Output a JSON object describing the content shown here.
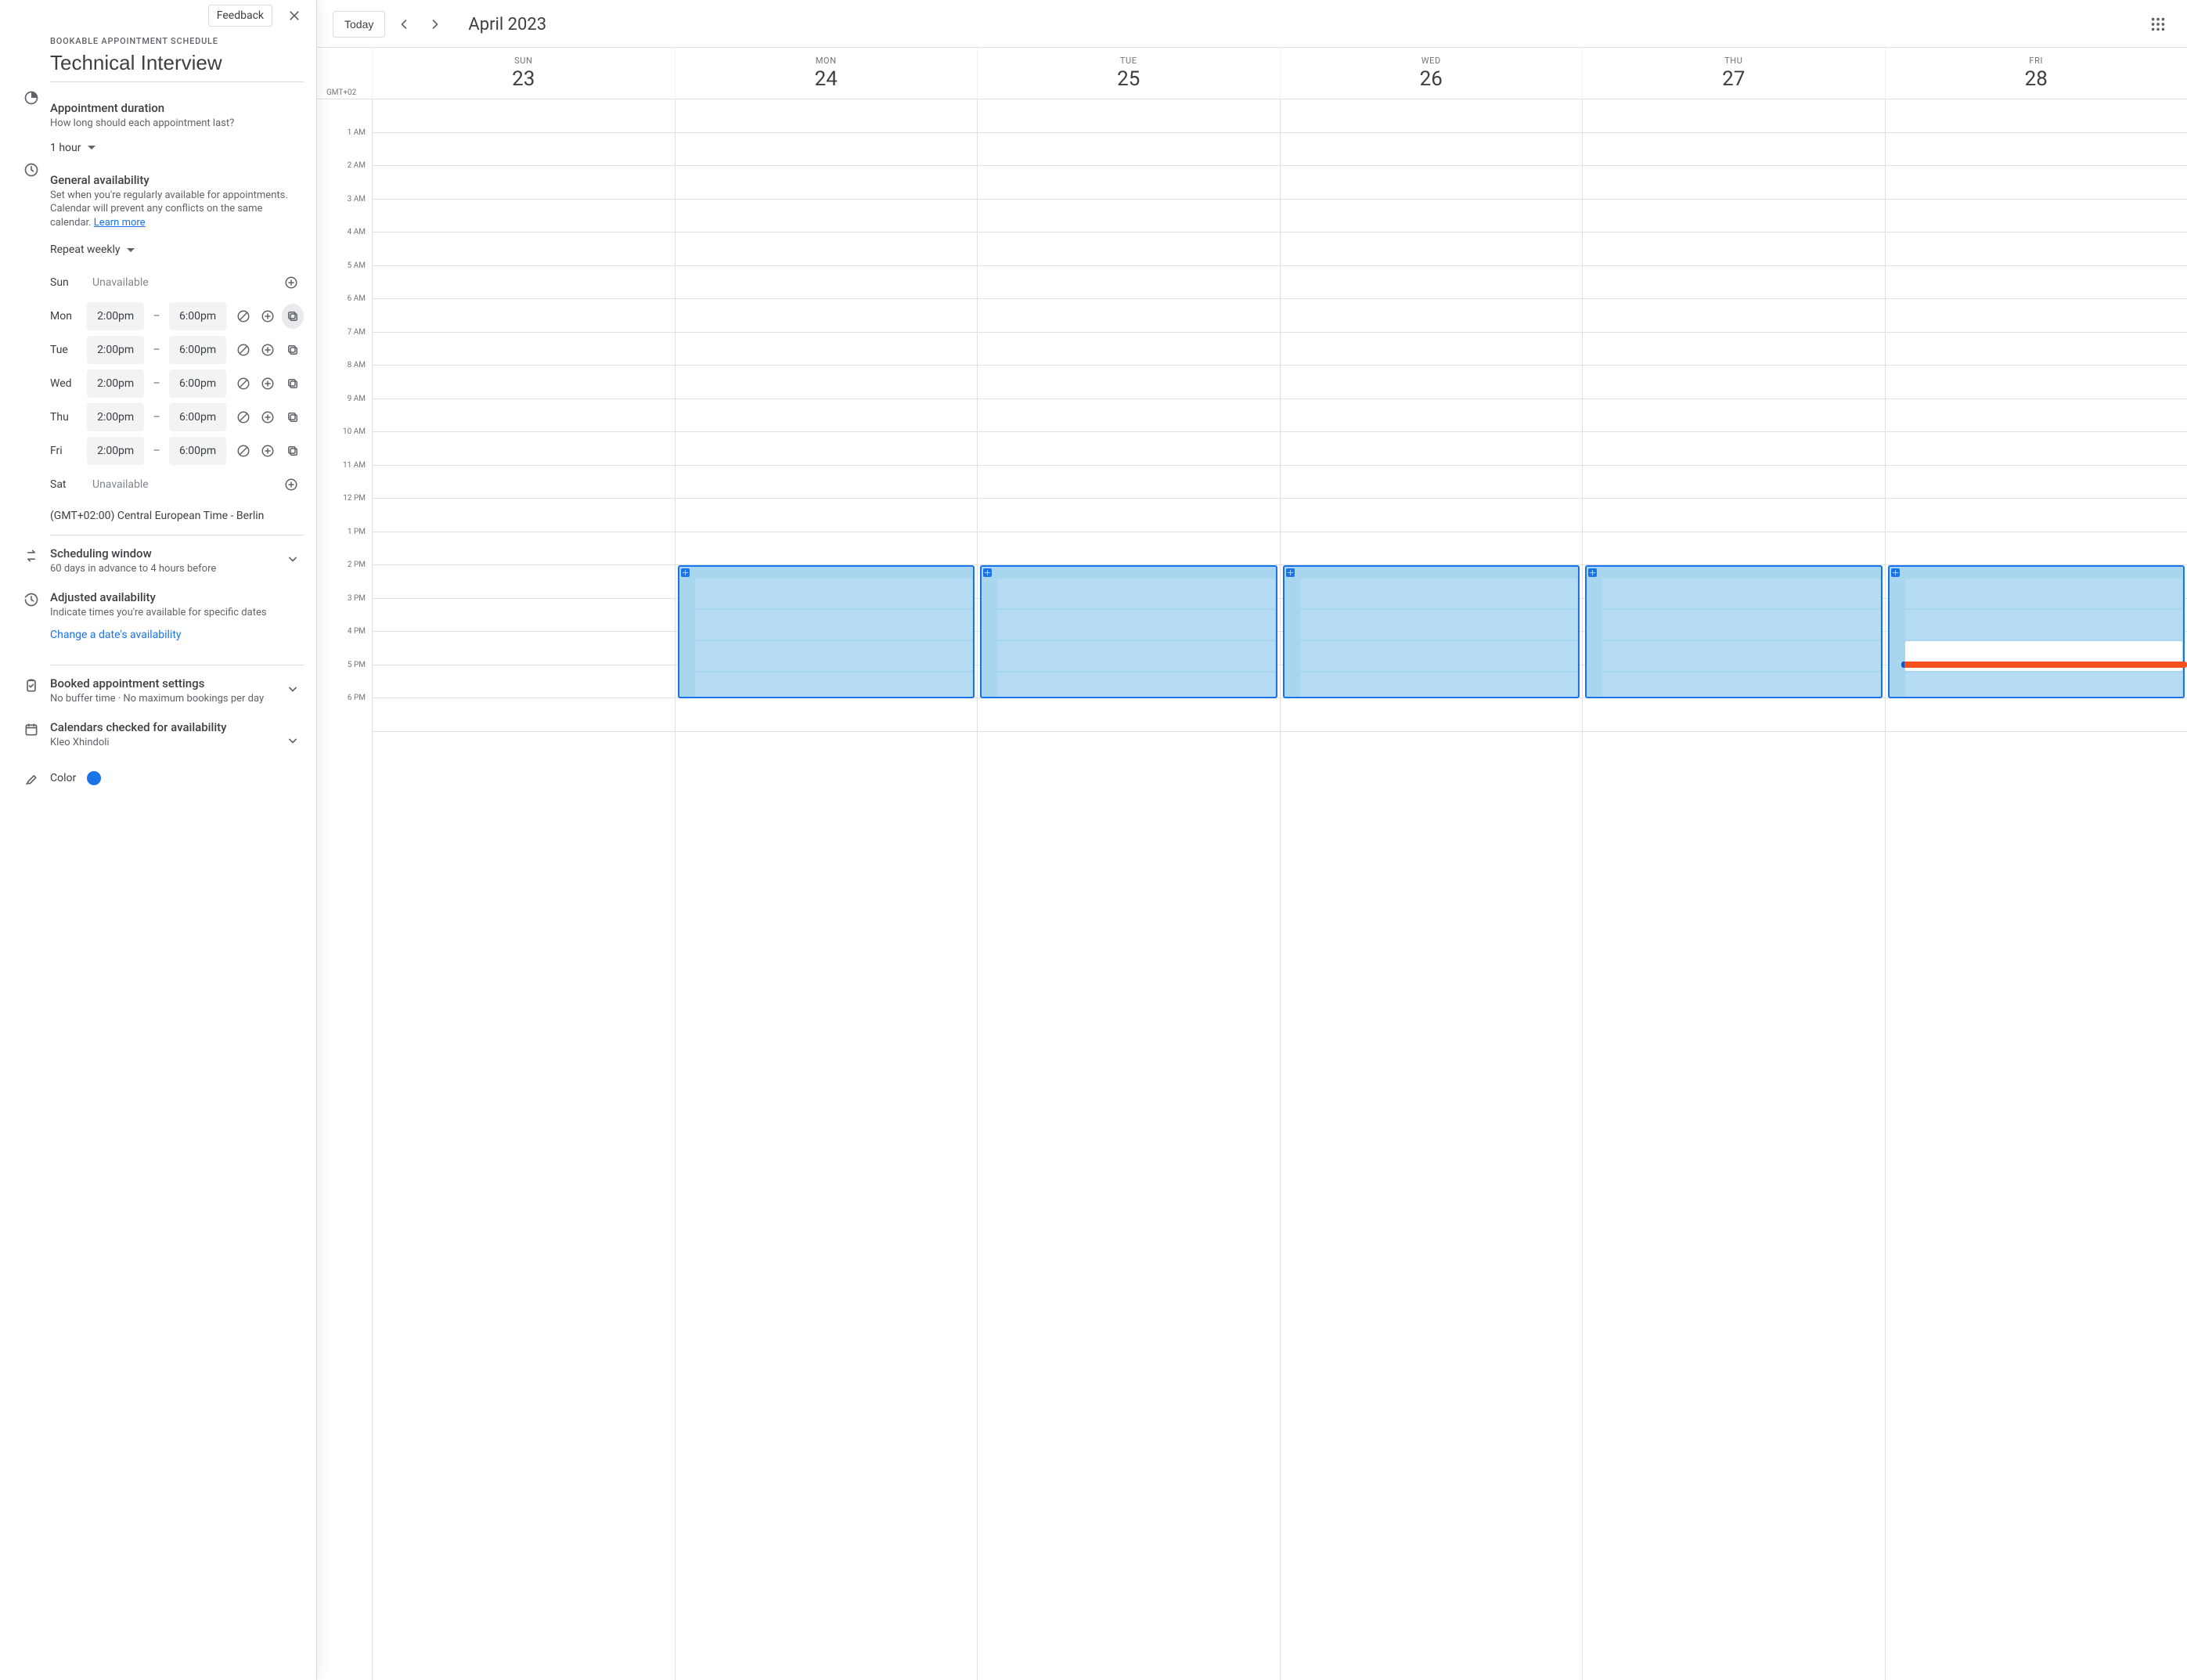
{
  "sidebar": {
    "feedback": "Feedback",
    "kicker": "BOOKABLE APPOINTMENT SCHEDULE",
    "title": "Technical Interview",
    "duration": {
      "heading": "Appointment duration",
      "sub": "How long should each appointment last?",
      "value": "1 hour"
    },
    "availability": {
      "heading": "General availability",
      "sub": "Set when you're regularly available for appointments. Calendar will prevent any conflicts on the same calendar. ",
      "learn_more": "Learn more",
      "repeat": "Repeat weekly",
      "days": [
        {
          "label": "Sun",
          "unavailable": true,
          "unavailable_text": "Unavailable"
        },
        {
          "label": "Mon",
          "start": "2:00pm",
          "end": "6:00pm"
        },
        {
          "label": "Tue",
          "start": "2:00pm",
          "end": "6:00pm"
        },
        {
          "label": "Wed",
          "start": "2:00pm",
          "end": "6:00pm"
        },
        {
          "label": "Thu",
          "start": "2:00pm",
          "end": "6:00pm"
        },
        {
          "label": "Fri",
          "start": "2:00pm",
          "end": "6:00pm"
        },
        {
          "label": "Sat",
          "unavailable": true,
          "unavailable_text": "Unavailable"
        }
      ],
      "timezone": "(GMT+02:00) Central European Time - Berlin"
    },
    "scheduling_window": {
      "heading": "Scheduling window",
      "sub": "60 days in advance to 4 hours before"
    },
    "adjusted": {
      "heading": "Adjusted availability",
      "sub": "Indicate times you're available for specific dates",
      "link": "Change a date's availability"
    },
    "booked": {
      "heading": "Booked appointment settings",
      "sub": "No buffer time · No maximum bookings per day"
    },
    "checked": {
      "heading": "Calendars checked for availability",
      "sub": "Kleo Xhindoli"
    },
    "color_label": "Color",
    "color_value": "#1a73e8"
  },
  "calendar": {
    "today": "Today",
    "month": "April 2023",
    "tz": "GMT+02",
    "days": [
      {
        "dow": "SUN",
        "num": "23"
      },
      {
        "dow": "MON",
        "num": "24"
      },
      {
        "dow": "TUE",
        "num": "25"
      },
      {
        "dow": "WED",
        "num": "26"
      },
      {
        "dow": "THU",
        "num": "27"
      },
      {
        "dow": "FRI",
        "num": "28"
      }
    ],
    "hours": [
      "",
      "1 AM",
      "2 AM",
      "3 AM",
      "4 AM",
      "5 AM",
      "6 AM",
      "7 AM",
      "8 AM",
      "9 AM",
      "10 AM",
      "11 AM",
      "12 PM",
      "1 PM",
      "2 PM",
      "3 PM",
      "4 PM",
      "5 PM",
      "6 PM"
    ]
  }
}
